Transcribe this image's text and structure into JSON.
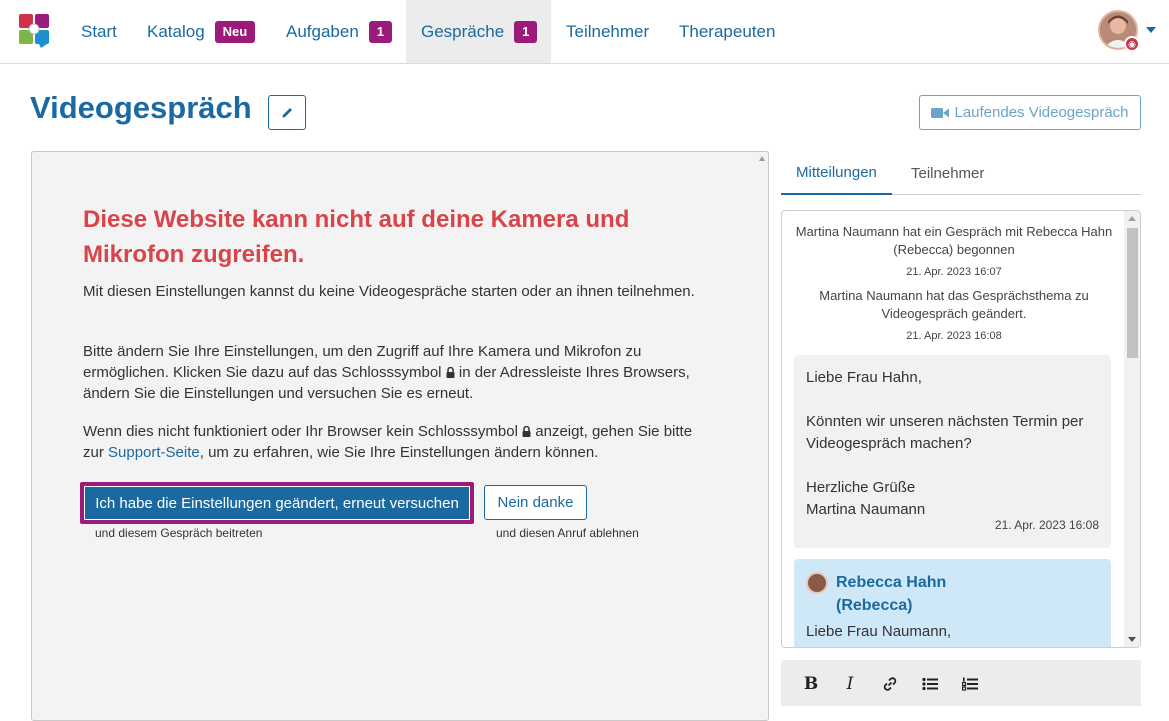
{
  "nav": {
    "items": [
      {
        "label": "Start"
      },
      {
        "label": "Katalog",
        "badge": "Neu"
      },
      {
        "label": "Aufgaben",
        "badge": "1"
      },
      {
        "label": "Gespräche",
        "badge": "1",
        "active": true
      },
      {
        "label": "Teilnehmer"
      },
      {
        "label": "Therapeuten"
      }
    ]
  },
  "page": {
    "title": "Videogespräch",
    "running_button": "Laufendes Videogespräch"
  },
  "video": {
    "error_title": "Diese Website kann nicht auf deine Kamera und Mikrofon zugreifen.",
    "p1": "Mit diesen Einstellungen kannst du keine Videogespräche starten oder an ihnen teilnehmen.",
    "p2_a": "Bitte ändern Sie Ihre Einstellungen, um den Zugriff auf Ihre Kamera und Mikrofon zu ermöglichen. Klicken Sie dazu auf das Schlosssymbol",
    "p2_b": "in der Adressleiste Ihres Browsers, ändern Sie die Einstellungen und versuchen Sie es erneut.",
    "p3_a": "Wenn dies nicht funktioniert oder Ihr Browser kein Schlosssymbol",
    "p3_b": "anzeigt, gehen Sie bitte zur",
    "p3_link": "Support-Seite",
    "p3_c": ", um zu erfahren, wie Sie Ihre Einstellungen ändern können.",
    "retry_button": "Ich habe die Einstellungen geändert, erneut versuchen",
    "retry_hint": "und diesem Gespräch beitreten",
    "decline_button": "Nein danke",
    "decline_hint": "und diesen Anruf ablehnen"
  },
  "side": {
    "tabs": [
      "Mitteilungen",
      "Teilnehmer"
    ],
    "system_messages": [
      {
        "text": "Martina Naumann hat ein Gespräch mit Rebecca Hahn (Rebecca) begonnen",
        "time": "21. Apr. 2023 16:07"
      },
      {
        "text": "Martina Naumann hat das Gesprächsthema zu Videogespräch geändert.",
        "time": "21. Apr. 2023 16:08"
      }
    ],
    "message1": {
      "line1": "Liebe Frau Hahn,",
      "line2": "Könnten wir unseren nächsten Termin per Videogespräch machen?",
      "line3": "Herzliche Grüße",
      "line4": "Martina Naumann",
      "time": "21. Apr. 2023 16:08"
    },
    "message2": {
      "sender": "Rebecca Hahn (Rebecca)",
      "line1": "Liebe Frau Naumann,"
    },
    "toolbar": {
      "bold": "B",
      "italic": "I"
    }
  },
  "colors": {
    "primary": "#1a6aa1",
    "accent": "#9b1a7a",
    "error": "#d9434a"
  }
}
